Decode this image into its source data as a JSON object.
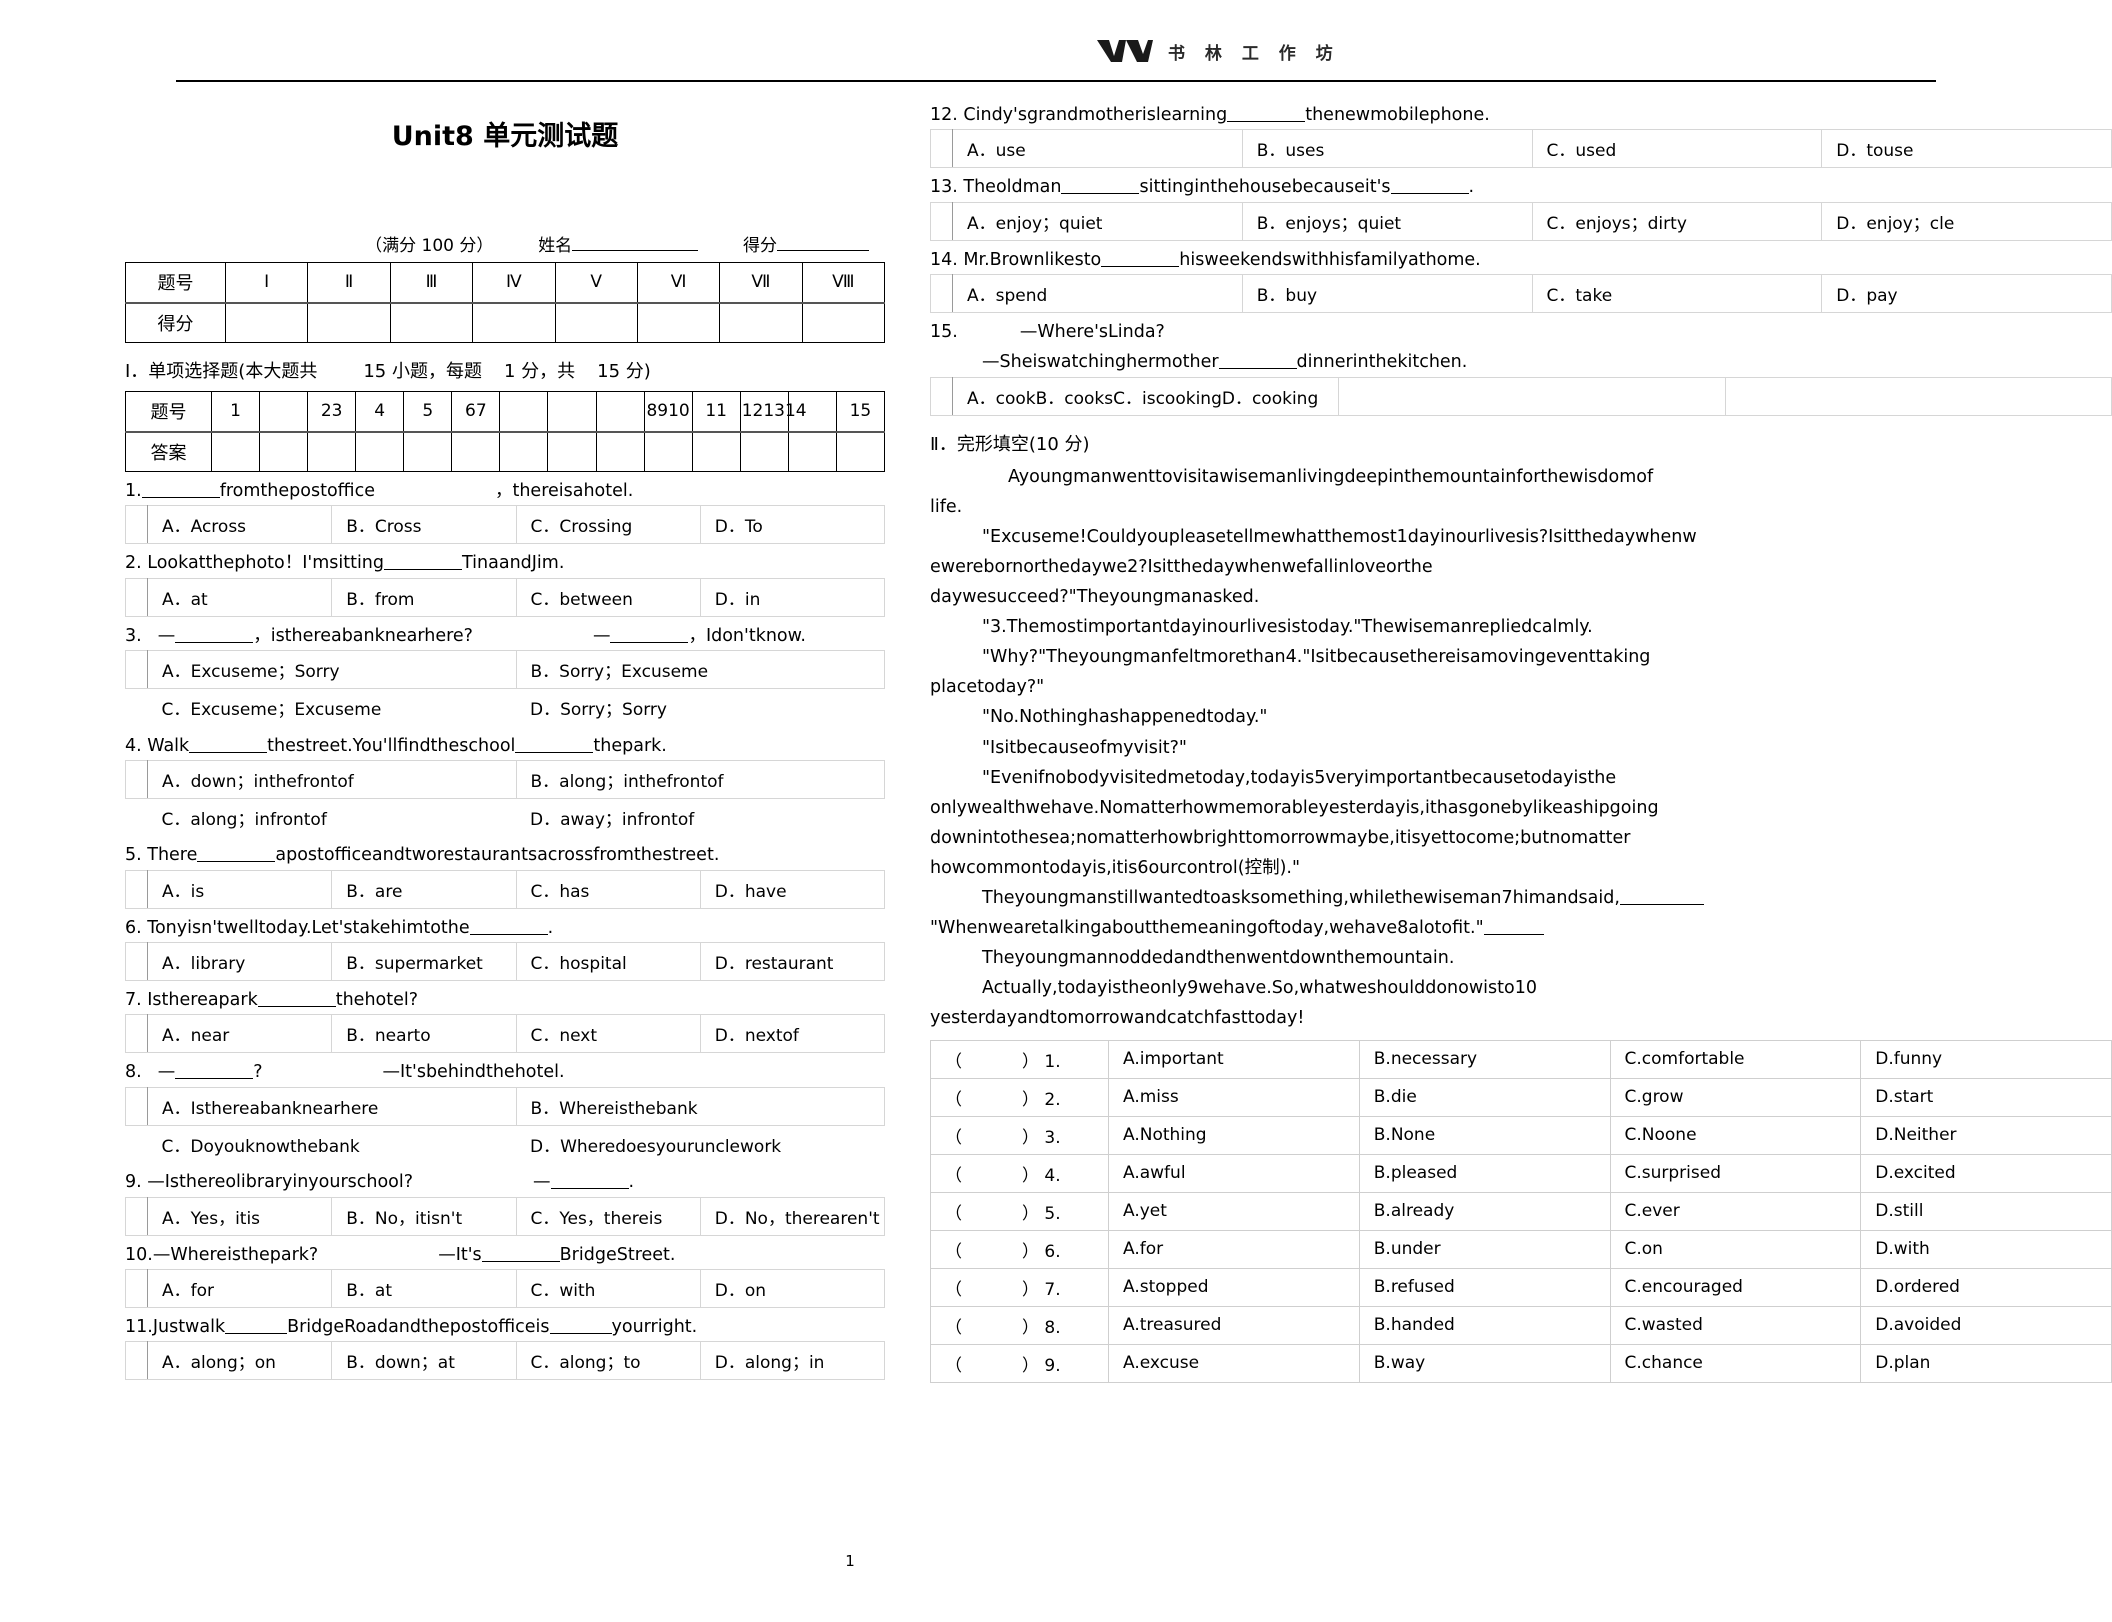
{
  "header": {
    "logo_icon": "shulin-workshop-logo",
    "logo_text": "书 林 工 作 坊"
  },
  "title": "Unit8 单元测试题",
  "meta": {
    "full_score": "（满分 100 分）",
    "name_label": "姓名",
    "score_label": "得分"
  },
  "score_table": {
    "row_label_1": "题号",
    "row_label_2": "得分",
    "columns": [
      "Ⅰ",
      "Ⅱ",
      "Ⅲ",
      "Ⅳ",
      "Ⅴ",
      "Ⅵ",
      "Ⅶ",
      "Ⅷ"
    ]
  },
  "section1": {
    "heading_a": "Ⅰ．单项选择题(本大题共",
    "heading_b": "15 小题，每题",
    "heading_c": "1 分，共",
    "heading_d": "15 分)",
    "answer_table": {
      "row_label_1": "题号",
      "row_label_2": "答案",
      "numbers": [
        "1",
        "",
        "23",
        "4",
        "5",
        "67",
        "",
        "",
        "",
        "8910",
        "11",
        "121314",
        "",
        "15"
      ]
    },
    "questions": [
      {
        "stem_parts": [
          "1.",
          "fromthepostoffice",
          "，thereisahotel."
        ],
        "layout": "one-row",
        "options": [
          "A．Across",
          "B．Cross",
          "C．Crossing",
          "D．To"
        ]
      },
      {
        "stem_parts": [
          "2. Lookatthephoto！I'msitting",
          "TinaandJim."
        ],
        "layout": "one-row",
        "options": [
          "A．at",
          "B．from",
          "C．between",
          "D．in"
        ]
      },
      {
        "stem_parts": [
          "3.",
          "—",
          "，isthereabanknearhere?",
          "—",
          "，Idon'tknow."
        ],
        "layout": "two-row",
        "options": [
          "A．Excuseme；Sorry",
          "B．Sorry；Excuseme",
          "C．Excuseme；Excuseme",
          "D．Sorry；Sorry"
        ]
      },
      {
        "stem_parts": [
          "4. Walk",
          "thestreet.You'llfindtheschool",
          "thepark."
        ],
        "layout": "two-row",
        "options": [
          "A．down；inthefrontof",
          "B．along；inthefrontof",
          "C．along；infrontof",
          "D．away；infrontof"
        ]
      },
      {
        "stem_parts": [
          "5. There",
          "apostofficeandtworestaurantsacrossfromthestreet."
        ],
        "layout": "one-row",
        "options": [
          "A．is",
          "B．are",
          "C．has",
          "D．have"
        ]
      },
      {
        "stem_parts": [
          "6. Tonyisn'twelltoday.Let'stakehimtothe",
          "."
        ],
        "layout": "one-row",
        "options": [
          "A．library",
          "B．supermarket",
          "C．hospital",
          "D．restaurant"
        ]
      },
      {
        "stem_parts": [
          "7. Isthereapark",
          "thehotel?"
        ],
        "layout": "one-row",
        "options": [
          "A．near",
          "B．nearto",
          "C．next",
          "D．nextof"
        ]
      },
      {
        "stem_parts": [
          "8.",
          "—",
          "?",
          "—It'sbehindthehotel."
        ],
        "layout": "two-row",
        "options": [
          "A．Isthereabanknearhere",
          "B．Whereisthebank",
          "C．Doyouknowthebank",
          "D．Wheredoesyourunclework"
        ]
      },
      {
        "stem_parts": [
          "9. —Isthereolibraryinyourschool?",
          "—",
          "."
        ],
        "layout": "one-row",
        "options": [
          "A．Yes，itis",
          "B．No，itisn't",
          "C．Yes，thereis",
          "D．No，therearen't"
        ]
      },
      {
        "stem_parts": [
          "10.—Whereisthepark?",
          "—It's",
          "BridgeStreet."
        ],
        "layout": "one-row",
        "options": [
          "A．for",
          "B．at",
          "C．with",
          "D．on"
        ]
      },
      {
        "stem_parts": [
          "11.Justwalk",
          "BridgeRoadandthepostofficeis",
          "yourright."
        ],
        "layout": "one-row",
        "options": [
          "A．along；on",
          "B．down；at",
          "C．along；to",
          "D．along；in"
        ]
      },
      {
        "stem_parts": [
          "12. Cindy'sgrandmotherislearning",
          "thenewmobilephone."
        ],
        "layout": "one-row",
        "options": [
          "A．use",
          "B．uses",
          "C．used",
          "D．touse"
        ]
      },
      {
        "stem_parts": [
          "13. Theoldman",
          "sittinginthehousebecauseit's",
          "."
        ],
        "layout": "one-row",
        "options": [
          "A．enjoy；quiet",
          "B．enjoys；quiet",
          "C．enjoys；dirty",
          "D．enjoy；cle"
        ]
      },
      {
        "stem_parts": [
          "14. Mr.Brownlikesto",
          "hisweekendswithhisfamilyathome."
        ],
        "layout": "one-row",
        "options": [
          "A．spend",
          "B．buy",
          "C．take",
          "D．pay"
        ]
      },
      {
        "stem_parts": [
          "15.",
          "—Where'sLinda?",
          "—Sheiswatchinghermother",
          "dinnerinthekitchen."
        ],
        "layout": "merged",
        "options": [
          "A．cookB．cooksC．iscookingD．cooking",
          "",
          "",
          ""
        ]
      }
    ]
  },
  "section2": {
    "heading": "Ⅱ．完形填空(10 分)",
    "paragraphs": [
      "Ayoungmanwenttovisitawisemanlivingdeepinthemountainforthewisdomof",
      "life.",
      "\"Excuseme!Couldyoupleasetellmewhatthemost1dayinourlivesis?Isitthedaywhenw",
      "ewerebornorthedaywe2?Isitthedaywhenwefallinloveorthe",
      "daywesucceed?\"Theyoungmanasked.",
      "\"3.Themostimportantdayinourlivesistoday.\"Thewisemanrepliedcalmly.",
      "\"Why?\"Theyoungmanfeltmorethan4.\"Isitbecausethereisamovingeventtaking",
      "placetoday?\"",
      "\"No.Nothinghashappenedtoday.\"",
      "\"Isitbecauseofmyvisit?\"",
      "\"Evenifnobodyvisitedmetoday,todayis5veryimportantbecausetodayisthe",
      "onlywealthwehave.Nomatterhowmemorableyesterdayis,ithasgonebylikeashipgoing",
      "downintothesea;nomatterhowbrighttomorrowmaybe,itisyettocome;butnomatter",
      "howcommontodayis,itis6ourcontrol(控制).\"",
      "Theyoungmanstillwantedtoasksomething,whilethewiseman7himandsaid,",
      "\"Whenwearetalkingaboutthemeaningoftoday,wehave8alotofit.\"",
      "Theyoungmannoddedandthenwentdownthemountain.",
      "Actually,todayistheonly9wehave.So,whatweshoulddonowisto10",
      "yesterdayandtomorrowandcatchfasttoday!"
    ],
    "underlined": [
      "Isitthedaywhenw",
      "orthe",
      "Themostimportantday",
      "because",
      "because",
      "(控制)"
    ],
    "answer_rows": [
      {
        "num": "1.",
        "a": "A.important",
        "b": "B.necessary",
        "c": "C.comfortable",
        "d": "D.funny"
      },
      {
        "num": "2.",
        "a": "A.miss",
        "b": "B.die",
        "c": "C.grow",
        "d": "D.start"
      },
      {
        "num": "3.",
        "a": "A.Nothing",
        "b": "B.None",
        "c": "C.Noone",
        "d": "D.Neither"
      },
      {
        "num": "4.",
        "a": "A.awful",
        "b": "B.pleased",
        "c": "C.surprised",
        "d": "D.excited"
      },
      {
        "num": "5.",
        "a": "A.yet",
        "b": "B.already",
        "c": "C.ever",
        "d": "D.still"
      },
      {
        "num": "6.",
        "a": "A.for",
        "b": "B.under",
        "c": "C.on",
        "d": "D.with"
      },
      {
        "num": "7.",
        "a": "A.stopped",
        "b": "B.refused",
        "c": "C.encouraged",
        "d": "D.ordered"
      },
      {
        "num": "8.",
        "a": "A.treasured",
        "b": "B.handed",
        "c": "C.wasted",
        "d": "D.avoided"
      },
      {
        "num": "9.",
        "a": "A.excuse",
        "b": "B.way",
        "c": "C.chance",
        "d": "D.plan"
      }
    ],
    "paren_left": "（",
    "paren_right": "）"
  },
  "footer": {
    "page": "1"
  }
}
